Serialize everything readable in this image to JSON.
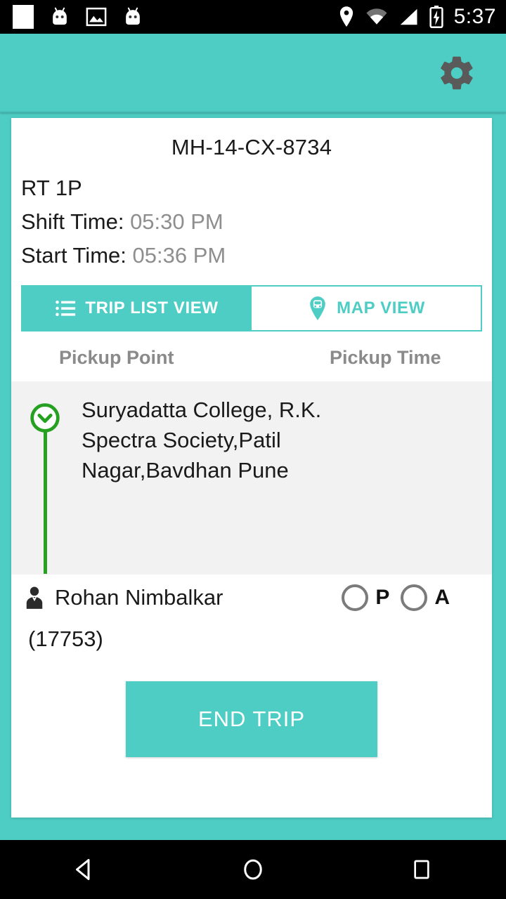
{
  "status_bar": {
    "left_icons": [
      "blank-square-icon",
      "android-robot-icon",
      "image-icon",
      "android-robot-icon"
    ],
    "right_icons": [
      "location-pin-icon",
      "wifi-icon",
      "signal-icon",
      "battery-charging-icon"
    ],
    "time": "5:37"
  },
  "app_bar": {
    "settings_icon": "gear-icon",
    "background_color": "#4ecdc4"
  },
  "trip": {
    "vehicle_number": "MH-14-CX-8734",
    "route_code": "RT 1P",
    "shift_time_label": "Shift Time:",
    "shift_time_value": "05:30 PM",
    "start_time_label": "Start Time:",
    "start_time_value": "05:36 PM"
  },
  "tabs": [
    {
      "label": "TRIP LIST VIEW",
      "icon": "list-icon",
      "active": true
    },
    {
      "label": "MAP VIEW",
      "icon": "bus-map-pin-icon",
      "active": false
    }
  ],
  "table": {
    "headers": {
      "point": "Pickup Point",
      "time": "Pickup Time"
    },
    "rows": [
      {
        "marker_icon": "chevron-down-circle-icon",
        "address": "Suryadatta College, R.K. Spectra Society,Patil Nagar,Bavdhan Pune",
        "pickup_time": ""
      }
    ]
  },
  "passenger": {
    "avatar_icon": "person-suit-icon",
    "name": "Rohan Nimbalkar",
    "employee_id": "(17753)",
    "attendance": [
      {
        "value": "P",
        "selected": false
      },
      {
        "value": "A",
        "selected": false
      }
    ]
  },
  "actions": {
    "end_trip_label": "END TRIP"
  },
  "nav_bar": {
    "back_icon": "back-triangle-icon",
    "home_icon": "home-circle-icon",
    "recents_icon": "recents-square-icon"
  },
  "colors": {
    "accent": "#4ecdc4",
    "marker_green": "#25a021",
    "muted_text": "#8e8e8e"
  }
}
